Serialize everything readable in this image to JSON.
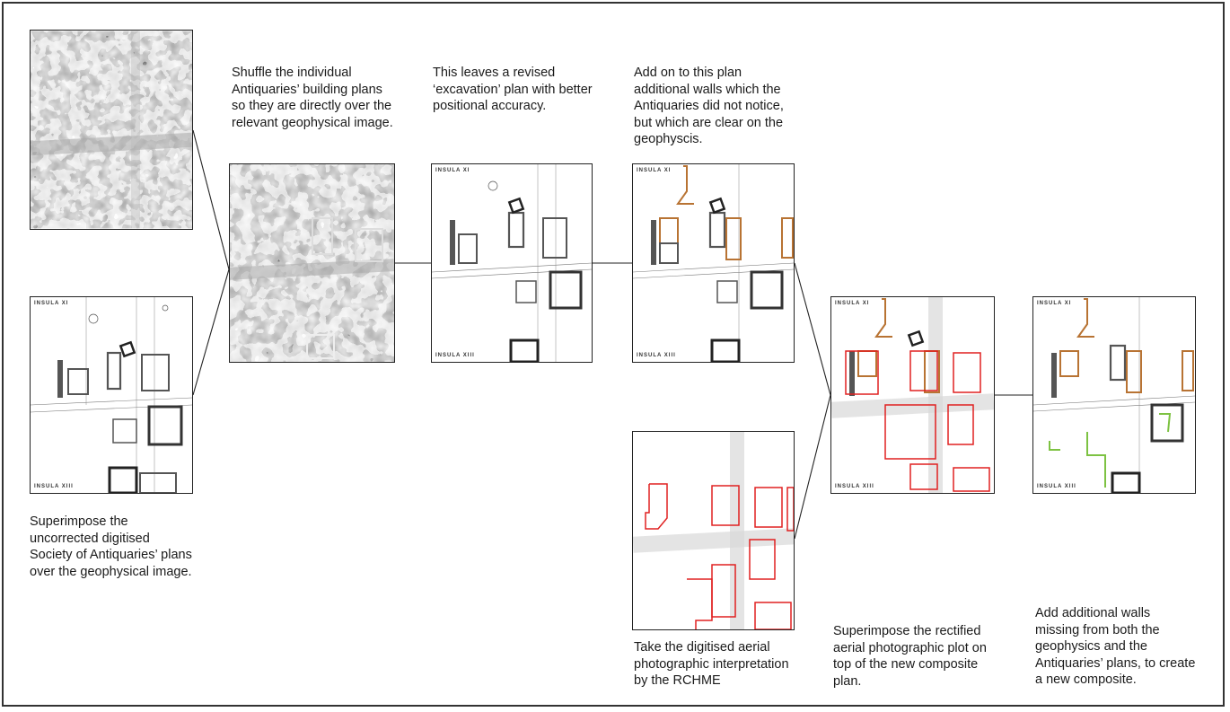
{
  "captions": {
    "step1": "Superimpose the\nuncorrected digitised\nSociety of Antiquaries’ plans\nover the geophysical image.",
    "step2": "Shuffle the individual\nAntiquaries’ building plans\nso they are directly over the\nrelevant geophysical image.",
    "step3": "This leaves a revised\n‘excavation’ plan with better\npositional accuracy.",
    "step4": "Add on to this plan\nadditional walls which the\nAntiquaries did not notice,\nbut which are clear on the\ngeophyscis.",
    "step5": "Take the digitised aerial\nphotographic interpretation\nby the RCHME",
    "step6": "Superimpose the rectified\naerial photographic plot on\ntop of the new composite\nplan.",
    "step7": "Add additional walls\nmissing from both the\ngeophysics and the\nAntiquaries’ plans, to create\na new composite."
  },
  "plan_labels": {
    "insula_top": "INSULA XI",
    "insula_bottom": "INSULA XIII"
  },
  "colors": {
    "wall": "#555555",
    "geophys_wall": "#b87333",
    "aerial": "#e02020",
    "new_wall": "#7dc242",
    "street_fill": "#cfcfcf"
  }
}
